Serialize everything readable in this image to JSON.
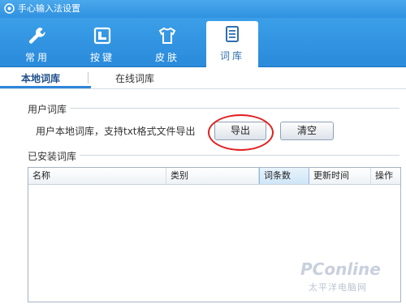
{
  "window": {
    "title": "手心输入法设置"
  },
  "toolbar": {
    "tabs": [
      {
        "label": "常用",
        "icon": "wrench-icon"
      },
      {
        "label": "按键",
        "icon": "keyboard-icon"
      },
      {
        "label": "皮肤",
        "icon": "tshirt-icon"
      },
      {
        "label": "词库",
        "icon": "document-icon"
      }
    ],
    "active_tab": "词库"
  },
  "subtabs": [
    {
      "label": "本地词库"
    },
    {
      "label": "在线词库"
    }
  ],
  "user_lexicon": {
    "section_title": "用户词库",
    "description": "用户本地词库，支持txt格式文件导出",
    "export_label": "导出",
    "clear_label": "清空"
  },
  "installed_lexicon": {
    "section_title": "已安装词库",
    "columns": [
      "名称",
      "类别",
      "词条数",
      "更新时间",
      "操作"
    ],
    "sorted_column": "词条数",
    "rows": []
  },
  "watermark": {
    "text": "PConline",
    "sub": "太平洋电脑网"
  },
  "colors": {
    "accent": "#2f92e0",
    "highlight_ring": "#e02020"
  }
}
